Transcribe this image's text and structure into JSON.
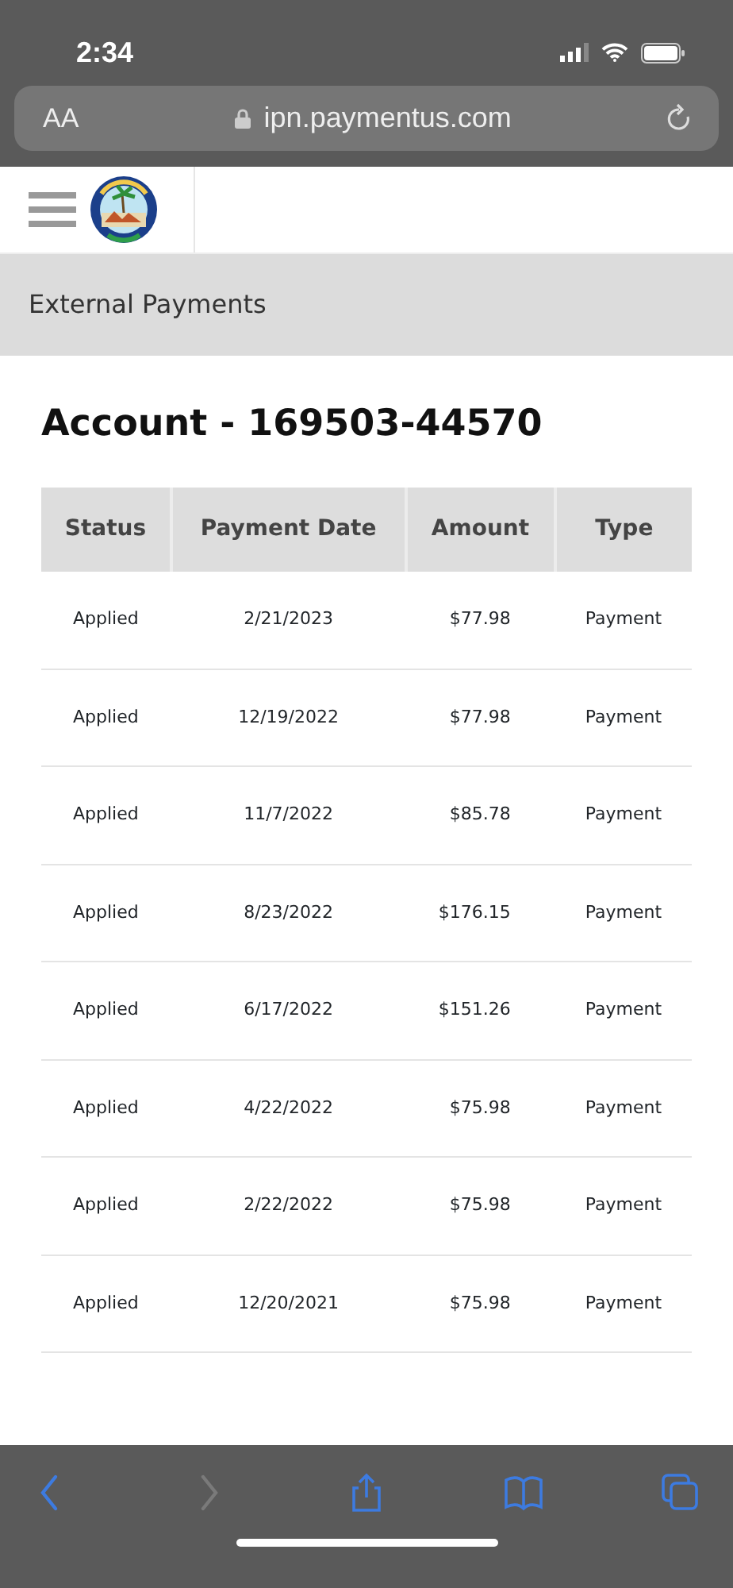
{
  "status_bar": {
    "time": "2:34"
  },
  "address_bar": {
    "text_size": "AA",
    "url": "ipn.paymentus.com"
  },
  "page_band": {
    "title": "External Payments"
  },
  "account": {
    "title": "Account - 169503-44570"
  },
  "table": {
    "columns": [
      "Status",
      "Payment Date",
      "Amount",
      "Type"
    ],
    "rows": [
      [
        "Applied",
        "2/21/2023",
        "$77.98",
        "Payment"
      ],
      [
        "Applied",
        "12/19/2022",
        "$77.98",
        "Payment"
      ],
      [
        "Applied",
        "11/7/2022",
        "$85.78",
        "Payment"
      ],
      [
        "Applied",
        "8/23/2022",
        "$176.15",
        "Payment"
      ],
      [
        "Applied",
        "6/17/2022",
        "$151.26",
        "Payment"
      ],
      [
        "Applied",
        "4/22/2022",
        "$75.98",
        "Payment"
      ],
      [
        "Applied",
        "2/22/2022",
        "$75.98",
        "Payment"
      ],
      [
        "Applied",
        "12/20/2021",
        "$75.98",
        "Payment"
      ]
    ]
  },
  "toolbar": [
    {
      "kind": "back",
      "disabled": false
    },
    {
      "kind": "forward",
      "disabled": true
    },
    {
      "kind": "share",
      "disabled": false
    },
    {
      "kind": "bookmarks",
      "disabled": false
    },
    {
      "kind": "tabs",
      "disabled": false
    }
  ]
}
